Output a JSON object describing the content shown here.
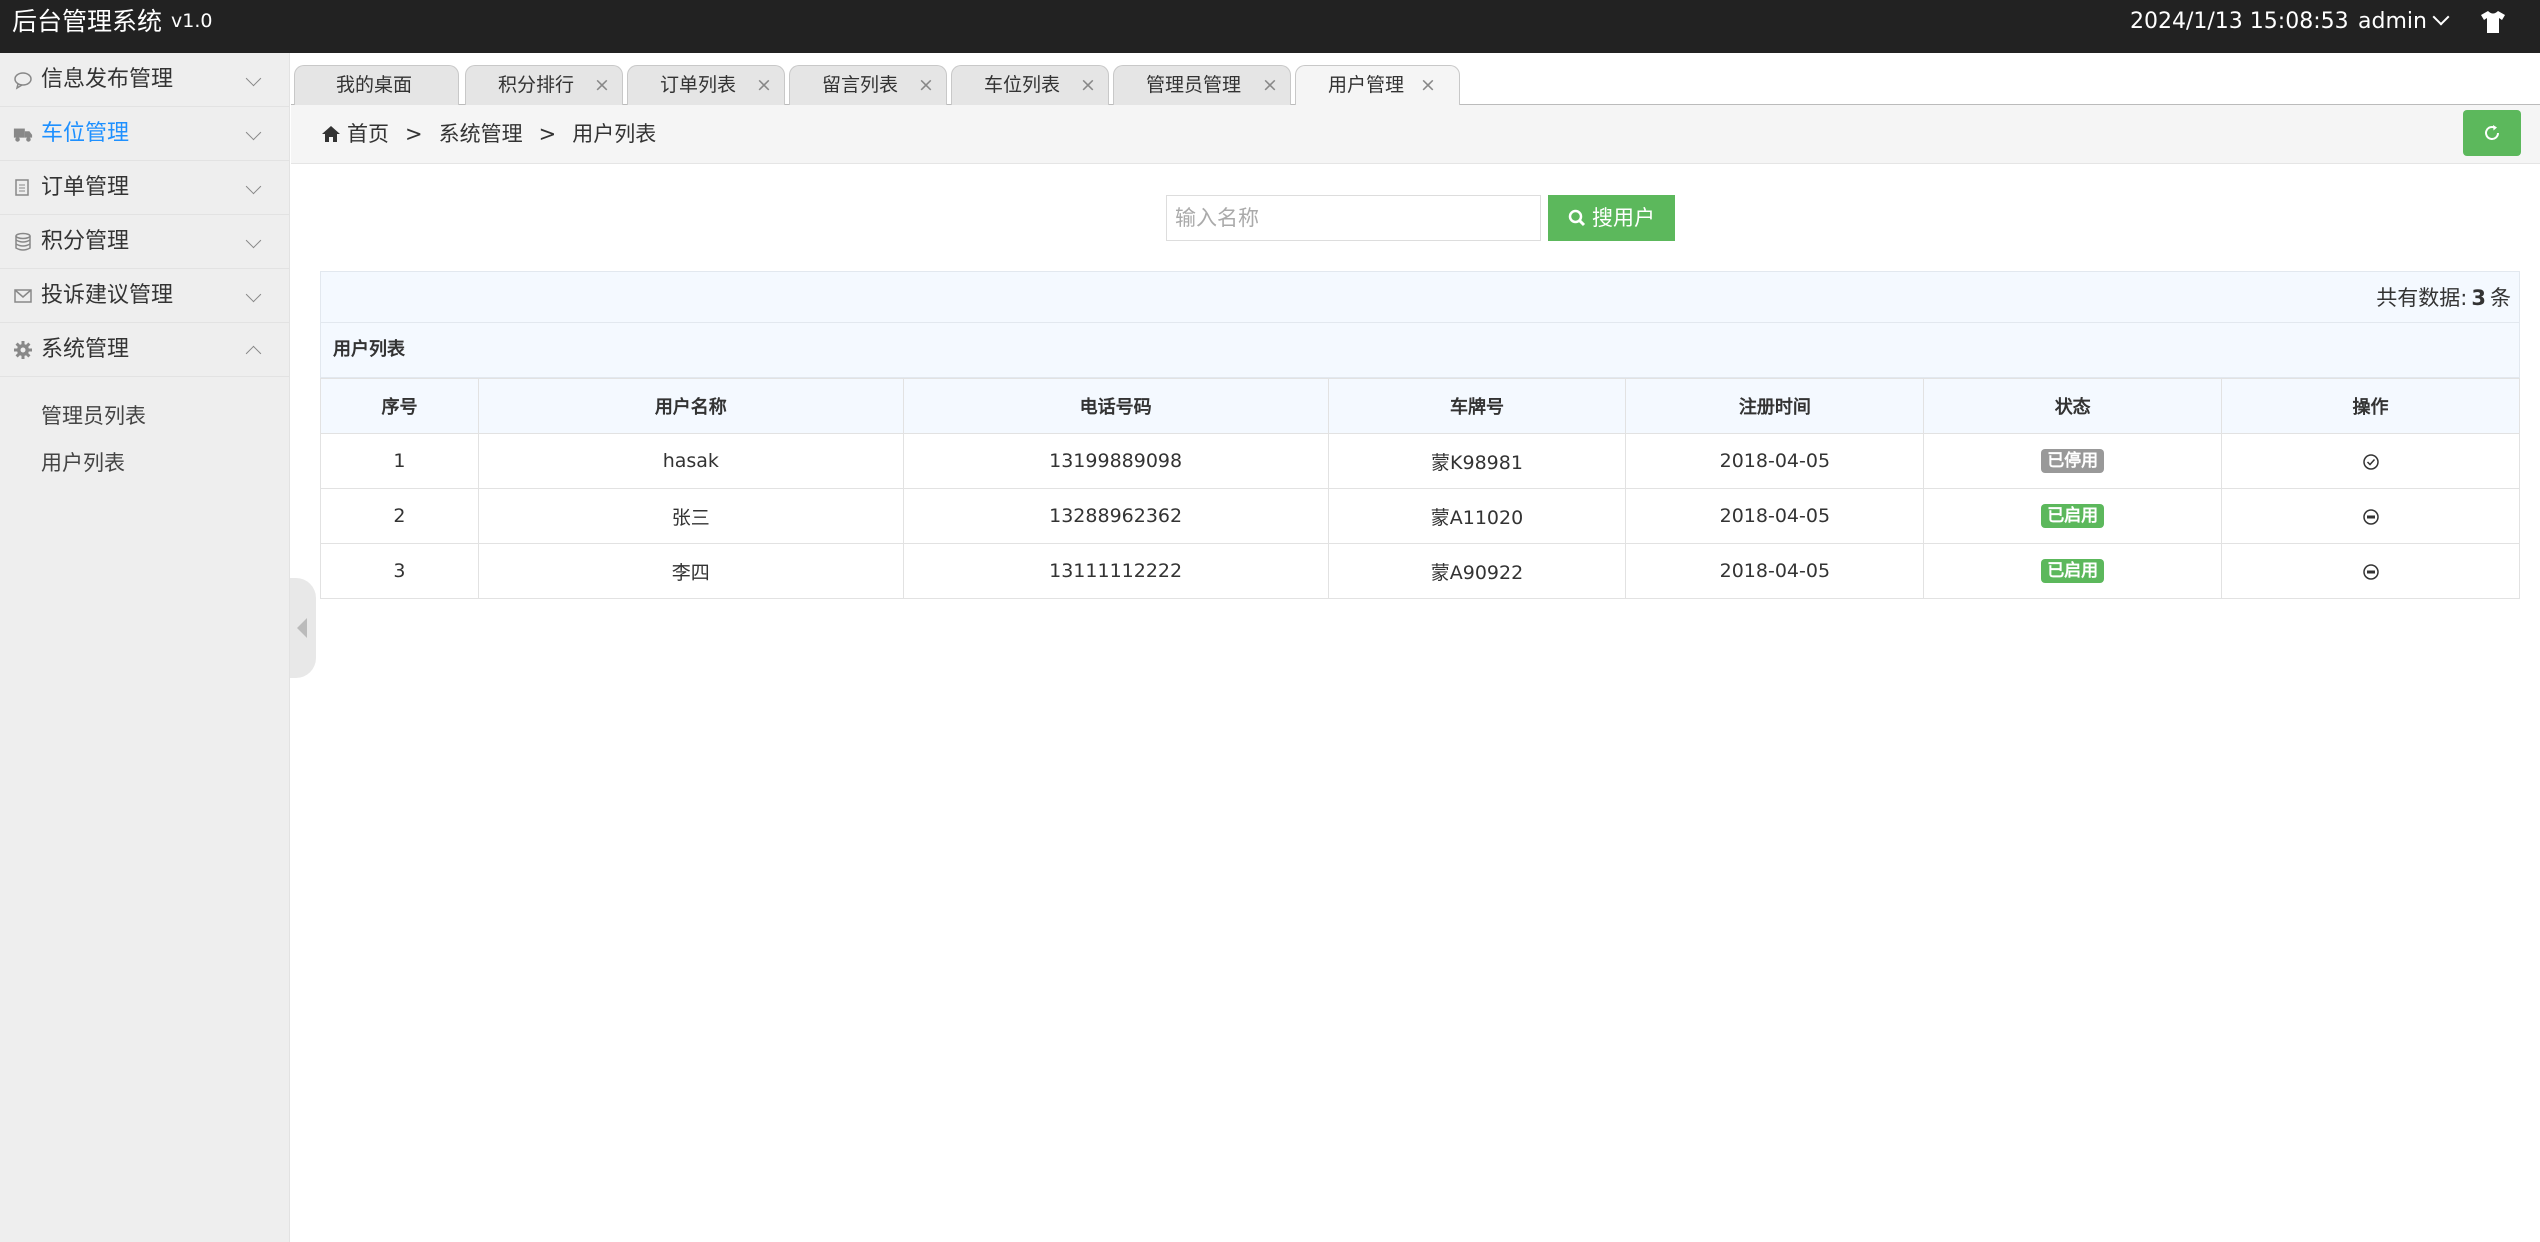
{
  "header": {
    "title": "后台管理系统",
    "version": "v1.0",
    "datetime": "2024/1/13 15:08:53",
    "user": "admin"
  },
  "sidebar": {
    "items": [
      {
        "label": "信息发布管理",
        "icon": "chat-icon"
      },
      {
        "label": "车位管理",
        "icon": "truck-icon",
        "active": true
      },
      {
        "label": "订单管理",
        "icon": "file-icon"
      },
      {
        "label": "积分管理",
        "icon": "database-icon"
      },
      {
        "label": "投诉建议管理",
        "icon": "envelope-icon"
      },
      {
        "label": "系统管理",
        "icon": "gear-icon",
        "expanded": true
      }
    ],
    "sub_items": [
      "管理员列表",
      "用户列表"
    ]
  },
  "tabs": [
    {
      "label": "我的桌面"
    },
    {
      "label": "积分排行"
    },
    {
      "label": "订单列表"
    },
    {
      "label": "留言列表"
    },
    {
      "label": "车位列表"
    },
    {
      "label": "管理员管理"
    },
    {
      "label": "用户管理",
      "active": true
    }
  ],
  "tab_close": "×",
  "breadcrumb": {
    "home": "首页",
    "sep": ">",
    "level1": "系统管理",
    "level2": "用户列表"
  },
  "search": {
    "placeholder": "输入名称",
    "button": "搜用户"
  },
  "total": {
    "prefix": "共有数据:",
    "count": "3",
    "suffix": "条"
  },
  "table": {
    "title": "用户列表",
    "headers": [
      "序号",
      "用户名称",
      "电话号码",
      "车牌号",
      "注册时间",
      "状态",
      "操作"
    ],
    "rows": [
      {
        "id": "1",
        "name": "hasak",
        "phone": "13199889098",
        "plate": "蒙K98981",
        "date": "2018-04-05",
        "status": "已停用",
        "status_color": "#999999"
      },
      {
        "id": "2",
        "name": "张三",
        "phone": "13288962362",
        "plate": "蒙A11020",
        "date": "2018-04-05",
        "status": "已启用",
        "status_color": "#5cb85c"
      },
      {
        "id": "3",
        "name": "李四",
        "phone": "13111112222",
        "plate": "蒙A90922",
        "date": "2018-04-05",
        "status": "已启用",
        "status_color": "#5cb85c"
      }
    ]
  },
  "colors": {
    "header_bg": "#222222",
    "accent": "#5cb85c",
    "active_menu": "#1e90ff"
  }
}
